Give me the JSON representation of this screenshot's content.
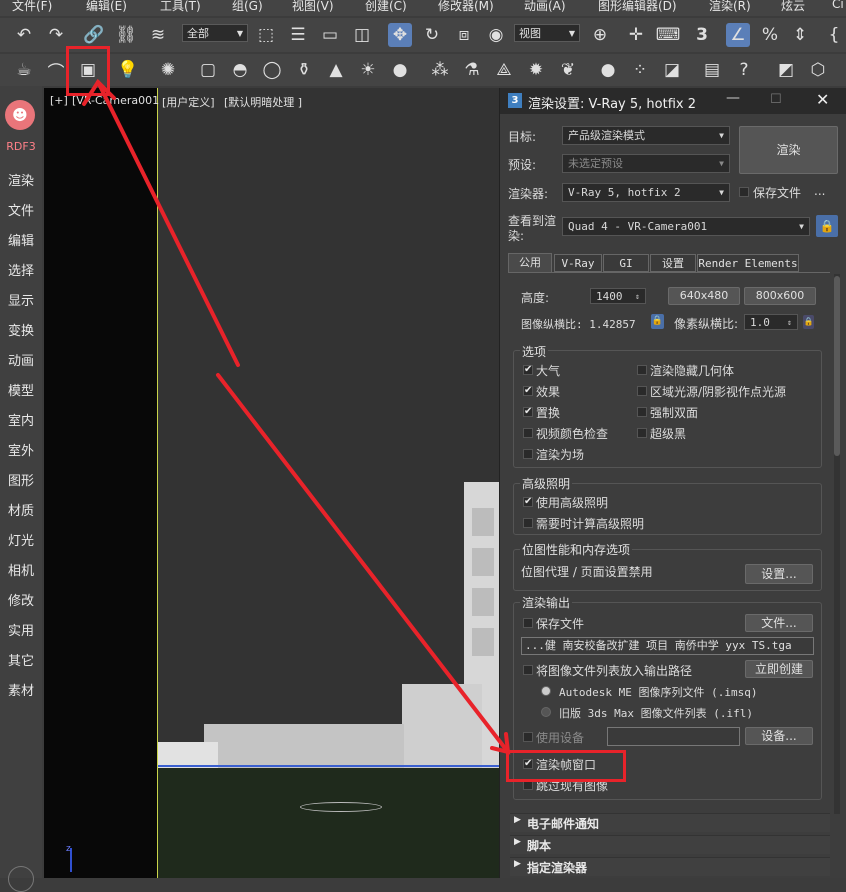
{
  "menubar": [
    "文件(F)",
    "编辑(E)",
    "工具(T)",
    "组(G)",
    "视图(V)",
    "创建(C)",
    "修改器(M)",
    "动画(A)",
    "图形编辑器(D)",
    "渲染(R)",
    "炫云",
    "Ci"
  ],
  "toolbar": {
    "selection_filter": "全部",
    "ref_coord": "视图",
    "snap_icon_text": "3"
  },
  "sidebar": [
    "RDF3",
    "渲染",
    "文件",
    "编辑",
    "选择",
    "显示",
    "变换",
    "动画",
    "模型",
    "室内",
    "室外",
    "图形",
    "材质",
    "灯光",
    "相机",
    "修改",
    "实用",
    "其它",
    "素材"
  ],
  "viewport": {
    "label_plus": "[+]",
    "label_camera": "[VR-Camera001",
    "label_user": "[用户定义]",
    "label_shading": "[默认明暗处理 ]"
  },
  "dialog": {
    "icon": "3",
    "title": "渲染设置: V-Ray 5, hotfix 2",
    "target_label": "目标:",
    "target_value": "产品级渲染模式",
    "preset_label": "预设:",
    "preset_value": "未选定预设",
    "renderer_label": "渲染器:",
    "renderer_value": "V-Ray 5, hotfix 2",
    "save_file_label": "保存文件",
    "ellipsis": "...",
    "view_label_1": "查看到渲",
    "view_label_2": "染:",
    "view_value": "Quad 4 - VR-Camera001",
    "render_button": "渲染",
    "tabs": [
      "公用",
      "V-Ray",
      "GI",
      "设置",
      "Render Elements"
    ],
    "height_label": "高度:",
    "height_value": "1400",
    "preset_640": "640x480",
    "preset_800": "800x600",
    "aspect_label": "图像纵横比: 1.42857",
    "pixel_aspect_label": "像素纵横比:",
    "pixel_aspect_value": "1.0",
    "options_title": "选项",
    "options": [
      {
        "label": "大气",
        "checked": true
      },
      {
        "label": "渲染隐藏几何体",
        "checked": false
      },
      {
        "label": "效果",
        "checked": true
      },
      {
        "label": "区域光源/阴影视作点光源",
        "checked": false
      },
      {
        "label": "置换",
        "checked": true
      },
      {
        "label": "强制双面",
        "checked": false
      },
      {
        "label": "视频颜色检查",
        "checked": false
      },
      {
        "label": "超级黑",
        "checked": false
      },
      {
        "label": "渲染为场",
        "checked": false
      }
    ],
    "adv_title": "高级照明",
    "adv_use": "使用高级照明",
    "adv_compute": "需要时计算高级照明",
    "bitmap_title": "位图性能和内存选项",
    "bitmap_text": "位图代理 / 页面设置禁用",
    "bitmap_setup": "设置...",
    "output_title": "渲染输出",
    "output_save": "保存文件",
    "output_files": "文件...",
    "output_path": "...健 南安校备改扩建 项目 南侨中学  yyx   TS.tga",
    "output_put_seq": "将图像文件列表放入输出路径",
    "output_create_now": "立即创建",
    "output_radio_1": "Autodesk ME 图像序列文件 (.imsq)",
    "output_radio_2": "旧版 3ds Max 图像文件列表 (.ifl)",
    "output_use_device": "使用设备",
    "output_devices": "设备...",
    "output_frame_window": "渲染帧窗口",
    "output_skip": "跳过现有图像",
    "rollouts": [
      "电子邮件通知",
      "脚本",
      "指定渲染器"
    ]
  },
  "colors": {
    "annotation_red": "#e8232a",
    "accent_blue": "#5b7fb8"
  }
}
